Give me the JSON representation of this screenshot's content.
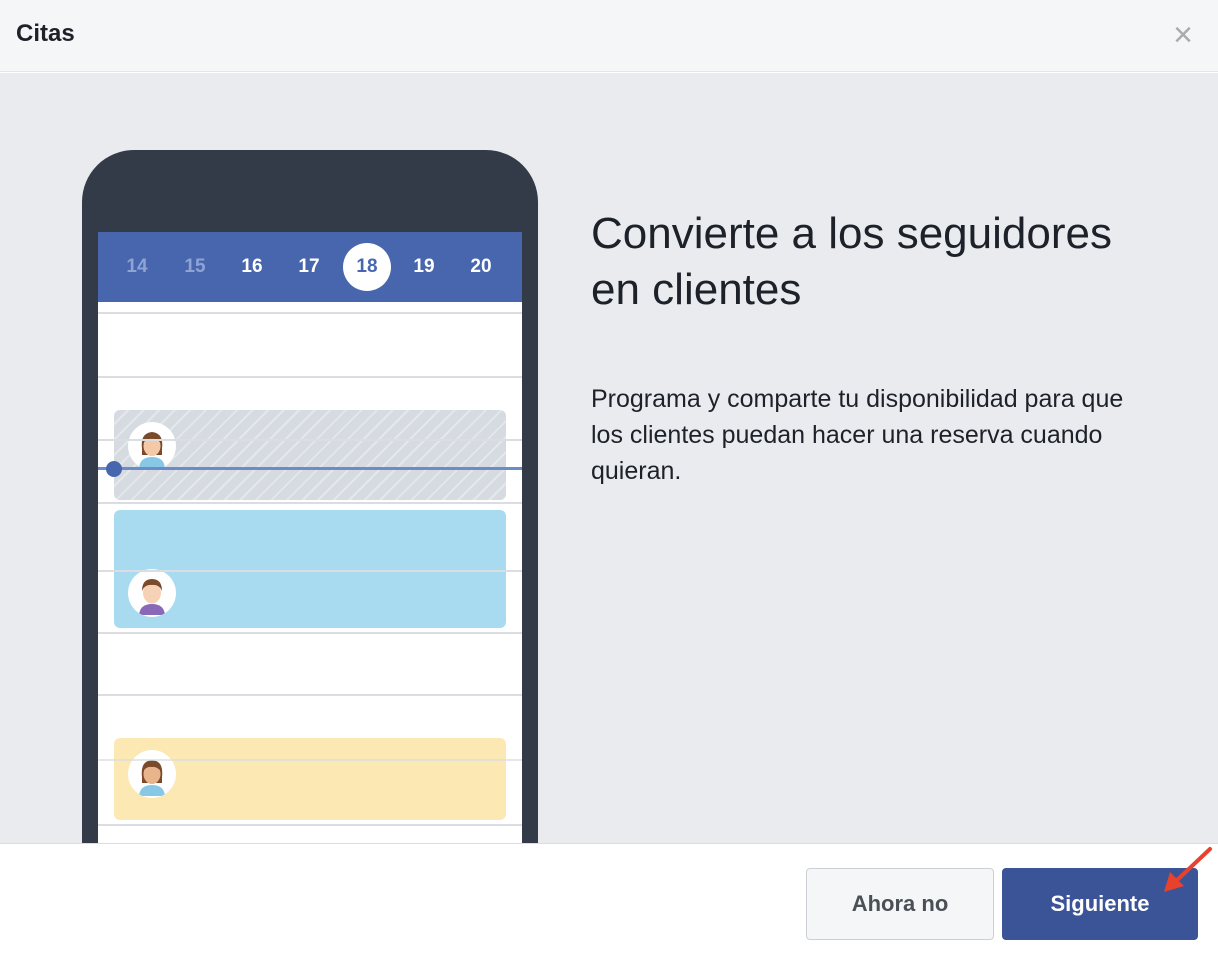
{
  "dialog": {
    "title": "Citas",
    "close_icon": "close-icon"
  },
  "calendar": {
    "dates": [
      {
        "label": "14",
        "state": "past"
      },
      {
        "label": "15",
        "state": "past"
      },
      {
        "label": "16",
        "state": "normal"
      },
      {
        "label": "17",
        "state": "normal"
      },
      {
        "label": "18",
        "state": "selected"
      },
      {
        "label": "19",
        "state": "normal"
      },
      {
        "label": "20",
        "state": "normal"
      }
    ],
    "colors": {
      "header": "#4766ad",
      "booked_slot": "#d5dbe0",
      "current_slot": "#a8dbf0",
      "upcoming_slot": "#fce8b3"
    }
  },
  "content": {
    "headline": "Convierte a los seguidores en clientes",
    "description": "Programa y comparte tu disponibilidad para que los clientes puedan hacer una reserva cuando quieran."
  },
  "footer": {
    "secondary_label": "Ahora no",
    "primary_label": "Siguiente",
    "primary_color": "#3b5498"
  },
  "annotation": {
    "arrow_color": "#e8412c"
  }
}
